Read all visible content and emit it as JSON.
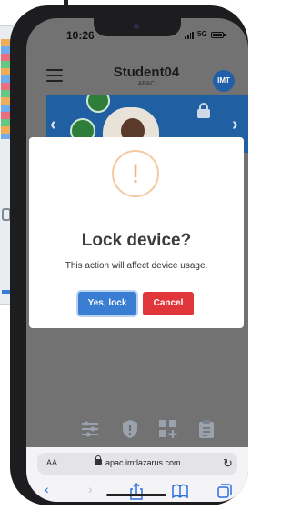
{
  "status": {
    "time": "10:26",
    "network": "5G"
  },
  "header": {
    "title": "Student04",
    "subtitle": "APAC",
    "avatar": "IMT"
  },
  "banner": {
    "prev": "‹",
    "next": "›"
  },
  "modal": {
    "icon": "!",
    "title": "Lock device?",
    "message": "This action will affect device usage.",
    "confirm_label": "Yes, lock",
    "cancel_label": "Cancel"
  },
  "toolbar": {
    "icons": [
      "sliders-icon",
      "shield-icon",
      "add-grid-icon",
      "clipboard-icon"
    ]
  },
  "browser": {
    "aa": "AA",
    "url": "apac.imtlazarus.com",
    "icons": [
      "back-icon",
      "forward-icon",
      "share-icon",
      "bookmarks-icon",
      "tabs-icon"
    ]
  },
  "colors": {
    "accent": "#3a7ed4",
    "danger": "#e0353b",
    "warning": "#f3c9a3",
    "avatar": "#2160a8"
  }
}
